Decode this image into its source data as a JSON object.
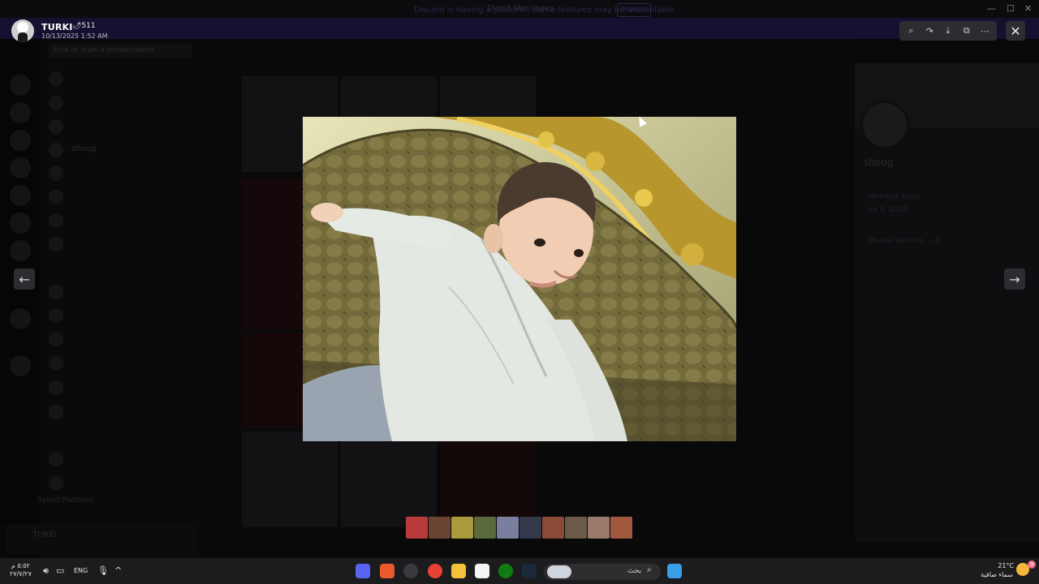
{
  "window": {
    "title": "Direct Messages",
    "controls": [
      "minimize",
      "maximize",
      "close"
    ]
  },
  "notice": {
    "text": "Discord is having a problem. Some features may be unavailable.",
    "button": "Dismiss"
  },
  "background": {
    "search_placeholder": "Find or start a conversation",
    "channel_header": "Direct",
    "dm_names": [
      "shoug",
      "TURKI"
    ],
    "profile_name": "shoug",
    "profile_member_since_label": "Member Since",
    "profile_member_since": "Jul 3, 2025",
    "profile_mutual": "Mutual Servers — 1",
    "select_platform": "Select Platform",
    "user_name": "TURKI"
  },
  "viewer": {
    "author": "TURKI",
    "author_badge": "🌶511",
    "timestamp": "10/13/2025 1:52 AM",
    "toolbar": [
      {
        "name": "zoom-icon",
        "glyph": "⌕"
      },
      {
        "name": "forward-icon",
        "glyph": "↷"
      },
      {
        "name": "download-icon",
        "glyph": "⤓"
      },
      {
        "name": "open-external-icon",
        "glyph": "⧉"
      },
      {
        "name": "more-icon",
        "glyph": "⋯"
      }
    ],
    "close_glyph": "✕",
    "prev_glyph": "←",
    "next_glyph": "→",
    "image_description": "photo",
    "thumbnails": [
      "#b83a3a",
      "#6b4332",
      "#a99b3e",
      "#5a6a3a",
      "#7a7fa0",
      "#353a4a",
      "#8a4a36",
      "#6a5a4a",
      "#9a7a6a",
      "#a0583e"
    ]
  },
  "taskbar": {
    "clock_time": "٥:٥٢ م",
    "clock_date": "٢٧/٧/٢٧",
    "lang": "ENG",
    "search_text": "بحث",
    "weather_temp": "21°C",
    "weather_desc": "سماء صافية",
    "notif_count": "9"
  }
}
